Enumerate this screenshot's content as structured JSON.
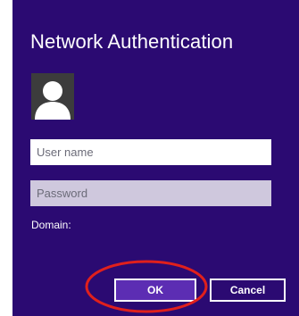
{
  "dialog": {
    "title": "Network Authentication",
    "background_color": "#2b0a72"
  },
  "avatar": {
    "icon": "user-silhouette-icon"
  },
  "fields": {
    "username_placeholder": "User name",
    "password_placeholder": "Password",
    "domain_label": "Domain:"
  },
  "buttons": {
    "ok_label": "OK",
    "cancel_label": "Cancel",
    "ok_color": "#5c2db3"
  },
  "annotation": {
    "highlight_color": "#e0201c",
    "shape": "ellipse around OK button"
  }
}
